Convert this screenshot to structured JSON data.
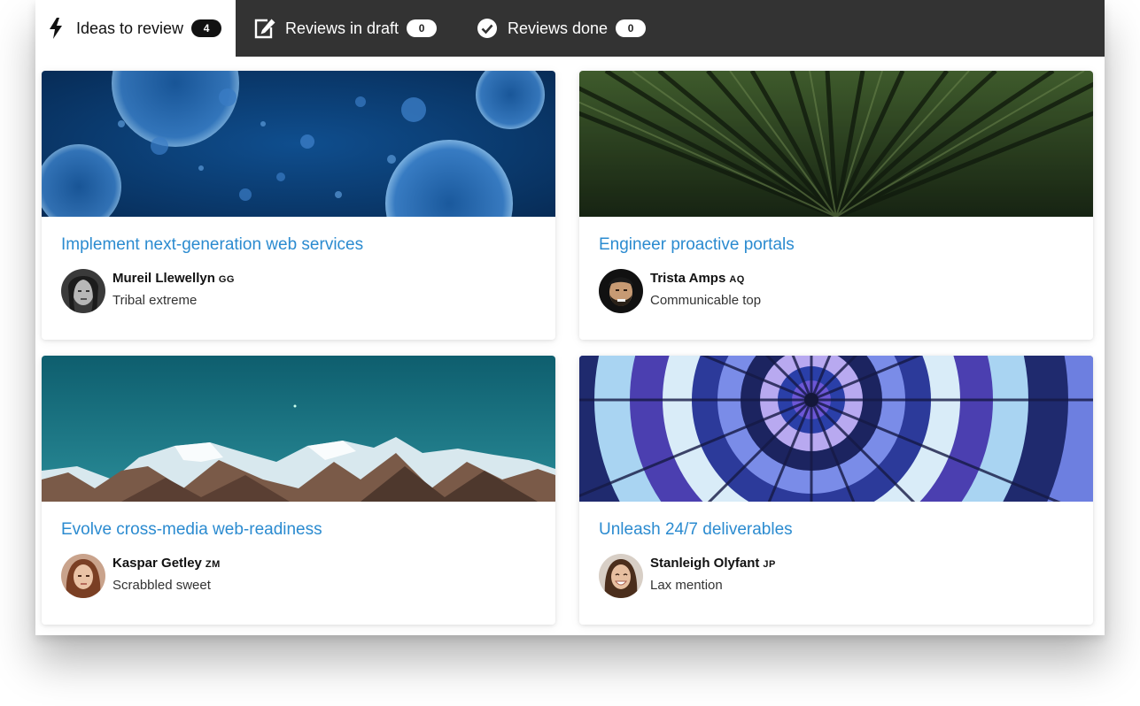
{
  "tabs": [
    {
      "label": "Ideas to review",
      "count": "4",
      "icon": "lightning-icon"
    },
    {
      "label": "Reviews in draft",
      "count": "0",
      "icon": "edit-icon"
    },
    {
      "label": "Reviews done",
      "count": "0",
      "icon": "check-circle-icon"
    }
  ],
  "cards": [
    {
      "title": "Implement next-generation web services",
      "author": "Mureil Llewellyn",
      "initials": "GG",
      "subtitle": "Tribal extreme",
      "image": "blue-bubbles"
    },
    {
      "title": "Engineer proactive portals",
      "author": "Trista Amps",
      "initials": "AQ",
      "subtitle": "Communicable top",
      "image": "green-leaf-lines"
    },
    {
      "title": "Evolve cross-media web-readiness",
      "author": "Kaspar Getley",
      "initials": "ZM",
      "subtitle": "Scrabbled sweet",
      "image": "snowy-mountains"
    },
    {
      "title": "Unleash 24/7 deliverables",
      "author": "Stanleigh Olyfant",
      "initials": "JP",
      "subtitle": "Lax mention",
      "image": "hot-air-balloon"
    }
  ],
  "colors": {
    "tabbar": "#333333",
    "title_link": "#2b8bd0",
    "active_tab": "#ffffff"
  }
}
